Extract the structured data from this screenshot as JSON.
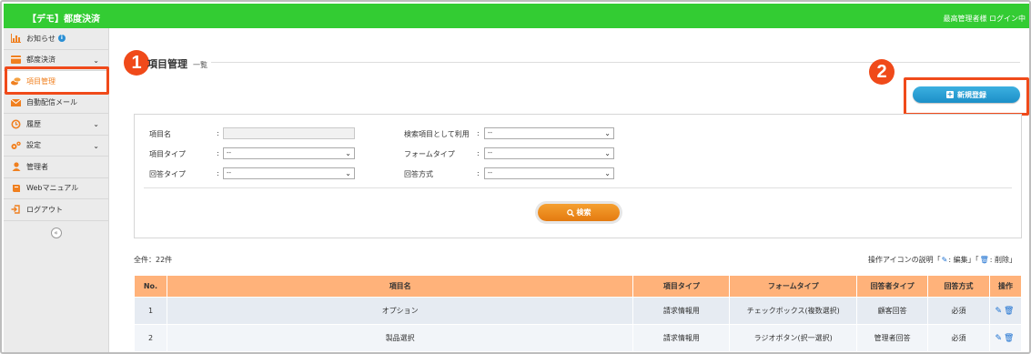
{
  "header": {
    "app_title": "【デモ】都度決済",
    "user_status": "最高管理者様 ログイン中"
  },
  "sidebar": {
    "items": [
      {
        "label": "お知らせ",
        "icon": "bar-chart-icon",
        "color": "#f08020",
        "badge": "i"
      },
      {
        "label": "都度決済",
        "icon": "credit-card-icon",
        "color": "#f08020",
        "chevron": "⌄"
      },
      {
        "label": "項目管理",
        "icon": "coins-icon",
        "color": "#f08020",
        "active": true
      },
      {
        "label": "自動配信メール",
        "icon": "envelope-icon",
        "color": "#f08020"
      },
      {
        "label": "履歴",
        "icon": "history-icon",
        "color": "#f08020",
        "chevron": "⌄"
      },
      {
        "label": "設定",
        "icon": "gears-icon",
        "color": "#f08020",
        "chevron": "⌄"
      },
      {
        "label": "管理者",
        "icon": "user-icon",
        "color": "#f08020"
      },
      {
        "label": "Webマニュアル",
        "icon": "book-icon",
        "color": "#f08020"
      },
      {
        "label": "ログアウト",
        "icon": "sign-out-icon",
        "color": "#f08020"
      }
    ],
    "collapse_glyph": "«"
  },
  "annotations": {
    "marker1": "1",
    "marker2": "2",
    "highlight_color": "#f04a1a"
  },
  "page": {
    "title": "項目管理",
    "subtitle": "一覧",
    "new_button": "新規登録"
  },
  "search": {
    "item_name": {
      "label": "項目名",
      "value": ""
    },
    "use_as_search": {
      "label": "検索項目として利用",
      "value": "--"
    },
    "item_type": {
      "label": "項目タイプ",
      "value": "--"
    },
    "form_type": {
      "label": "フォームタイプ",
      "value": "--"
    },
    "answer_type": {
      "label": "回答タイプ",
      "value": "--"
    },
    "answer_method": {
      "label": "回答方式",
      "value": "--"
    },
    "colon": ":",
    "search_button": "検索"
  },
  "list": {
    "count_text": "全件：22件",
    "legend_prefix": "操作アイコンの説明「",
    "legend_edit": ": 編集」「",
    "legend_delete": ": 削除」",
    "columns": [
      "No.",
      "項目名",
      "項目タイプ",
      "フォームタイプ",
      "回答者タイプ",
      "回答方式",
      "操作"
    ],
    "rows": [
      {
        "no": "1",
        "name": "オプション",
        "item_type": "請求情報用",
        "form_type": "チェックボックス(複数選択)",
        "answer_type": "顧客回答",
        "method": "必須"
      },
      {
        "no": "2",
        "name": "製品選択",
        "item_type": "請求情報用",
        "form_type": "ラジオボタン(択一選択)",
        "answer_type": "管理者回答",
        "method": "必須"
      }
    ]
  },
  "colors": {
    "header_green": "#33cc33",
    "accent_orange": "#f08020",
    "table_header": "#ffb27a",
    "primary_blue": "#1c8fc8"
  }
}
